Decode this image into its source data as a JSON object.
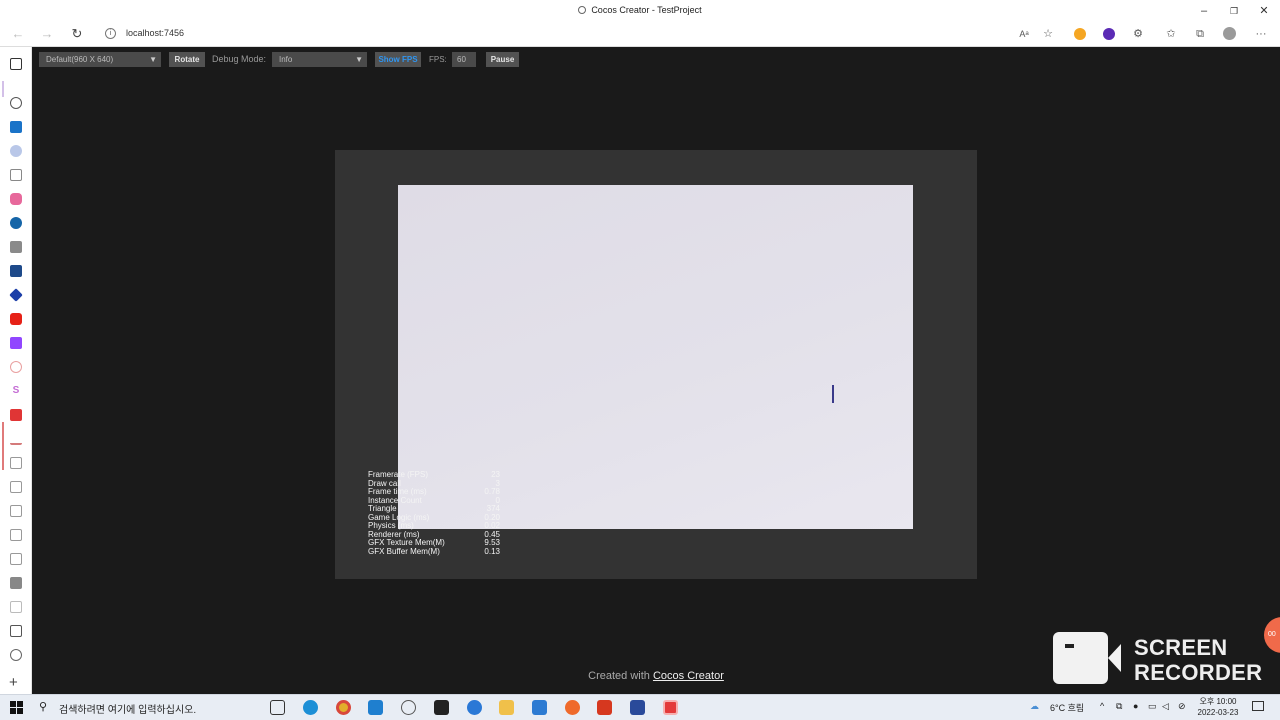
{
  "window": {
    "title": "Cocos Creator - TestProject",
    "controls": [
      "–",
      "❐",
      "✕"
    ]
  },
  "browser": {
    "url": "localhost:7456",
    "toolbar_icons": [
      "read-aloud-icon",
      "favorite-star-icon",
      "extension-orange-icon",
      "extension-purple-icon",
      "extensions-icon",
      "favorites-icon",
      "collections-icon",
      "profile-icon",
      "more-icon"
    ],
    "more_label": "···"
  },
  "cocos_toolbar": {
    "resolution": "Default(960 X 640)",
    "rotate_label": "Rotate",
    "debug_mode_label": "Debug Mode:",
    "debug_mode_value": "Info",
    "show_fps_label": "Show FPS",
    "fps_label": "FPS:",
    "fps_value": "60",
    "pause_label": "Pause"
  },
  "stats": [
    {
      "label": "Framerate (FPS)",
      "value": "23"
    },
    {
      "label": "Draw call",
      "value": "3"
    },
    {
      "label": "Frame time (ms)",
      "value": "0.78"
    },
    {
      "label": "Instance Count",
      "value": "0"
    },
    {
      "label": "Triangle",
      "value": "374"
    },
    {
      "label": "Game Logic (ms)",
      "value": "0.20"
    },
    {
      "label": "Physics (ms)",
      "value": "0.02"
    },
    {
      "label": "Renderer (ms)",
      "value": "0.45"
    },
    {
      "label": "GFX Texture Mem(M)",
      "value": "9.53"
    },
    {
      "label": "GFX Buffer Mem(M)",
      "value": "0.13"
    }
  ],
  "footer": {
    "prefix": "Created with",
    "link": "Cocos Creator"
  },
  "watermark": {
    "line1": "SCREEN",
    "line2": "RECORDER",
    "badge": "00"
  },
  "taskbar": {
    "search_placeholder": "검색하려면 여기에 입력하십시오.",
    "weather": "6°C 흐림",
    "time": "오후 10:00",
    "date": "2022-03-23",
    "apps": [
      "task-view",
      "edge",
      "chrome",
      "vscode",
      "cocos",
      "terminal",
      "app-blue",
      "file-explorer",
      "mail",
      "firefox",
      "office",
      "powershell",
      "recorder"
    ]
  },
  "colors": {
    "accent_blue": "#2f95f0",
    "game_bg": "#e3e1ea",
    "frame_bg": "#333333",
    "page_bg": "#1a1a1a"
  }
}
